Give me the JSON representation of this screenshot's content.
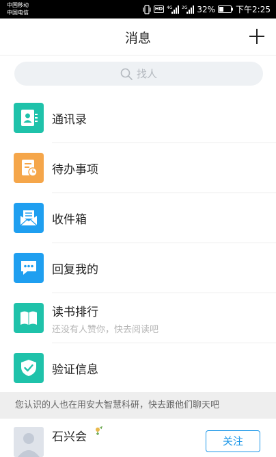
{
  "status_bar": {
    "carrier_1": "中国移动",
    "carrier_2": "中国电信",
    "hd_badge": "HD",
    "signal_1_label": "4G",
    "signal_2_label": "2G",
    "battery": "32%",
    "time": "下午2:25"
  },
  "header": {
    "title": "消息",
    "add_icon": "plus-icon"
  },
  "search": {
    "placeholder": "找人",
    "icon": "search-icon"
  },
  "menu": {
    "items": [
      {
        "label": "通讯录",
        "icon": "contacts-icon",
        "color": "#1fc2aa"
      },
      {
        "label": "待办事项",
        "icon": "todo-icon",
        "color": "#f5a64a"
      },
      {
        "label": "收件箱",
        "icon": "inbox-icon",
        "color": "#1f9ff0"
      },
      {
        "label": "回复我的",
        "icon": "reply-icon",
        "color": "#1f9ff0"
      },
      {
        "label": "读书排行",
        "sublabel": "还没有人赞你，快去阅读吧",
        "icon": "book-icon",
        "color": "#1fc2aa"
      },
      {
        "label": "验证信息",
        "icon": "shield-check-icon",
        "color": "#1fc2aa"
      }
    ]
  },
  "notice": {
    "text": "您认识的人也在用安大智慧科研，快去跟他们聊天吧"
  },
  "contact": {
    "name": "石兴会",
    "gender_icon": "gender-icon",
    "follow_label": "关注"
  },
  "colors": {
    "accent": "#1a96e8",
    "teal": "#1fc2aa",
    "orange": "#f5a64a",
    "blue": "#1f9ff0"
  }
}
